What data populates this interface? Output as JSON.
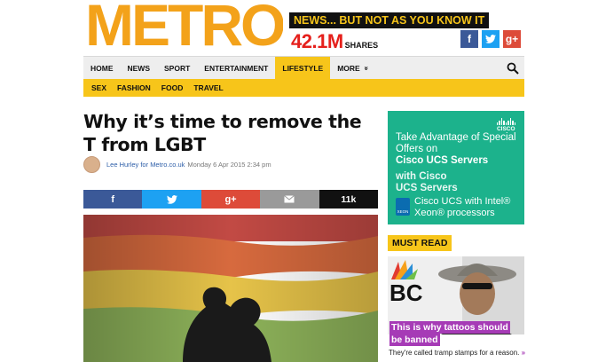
{
  "brand": {
    "logo": "METRO",
    "tagline": "NEWS... BUT NOT AS YOU KNOW IT",
    "shares_count": "42.1M",
    "shares_label": "SHARES"
  },
  "social_top": [
    {
      "icon": "facebook-icon",
      "glyph": "f",
      "color": "#3b5998"
    },
    {
      "icon": "twitter-icon",
      "glyph": "🐦",
      "color": "#1da1f2"
    },
    {
      "icon": "google-plus-icon",
      "glyph": "g+",
      "color": "#dd4b39"
    }
  ],
  "nav": {
    "items": [
      "HOME",
      "NEWS",
      "SPORT",
      "ENTERTAINMENT",
      "LIFESTYLE",
      "MORE"
    ],
    "active": "LIFESTYLE",
    "more_glyph": "»"
  },
  "subnav": {
    "items": [
      "SEX",
      "FASHION",
      "FOOD",
      "TRAVEL"
    ]
  },
  "article": {
    "title": "Why it’s time to remove the T from LGBT",
    "author": "Lee Hurley for Metro.co.uk",
    "date": "Monday 6 Apr 2015 2:34 pm",
    "share_count": "11k"
  },
  "ad": {
    "brand": "CISCO",
    "line1": "Take Advantage of Special Offers on",
    "line2": "Cisco UCS Servers",
    "ghost1": "with Cisco",
    "ghost2": "UCS Servers",
    "desc": "Cisco UCS with Intel® Xeon® processors",
    "chip": "XEON",
    "accent": "#1cb28c"
  },
  "must_read": {
    "label": "MUST READ",
    "title": "This is why tattoos should be banned",
    "subtitle": "They're called tramp stamps for a reason.",
    "arrow": "»",
    "logo_text": "BC",
    "accent": "#a63bb6"
  },
  "colors": {
    "brand_orange": "#f3a21a",
    "brand_yellow": "#f7c51a",
    "headline_red": "#e5201c"
  }
}
